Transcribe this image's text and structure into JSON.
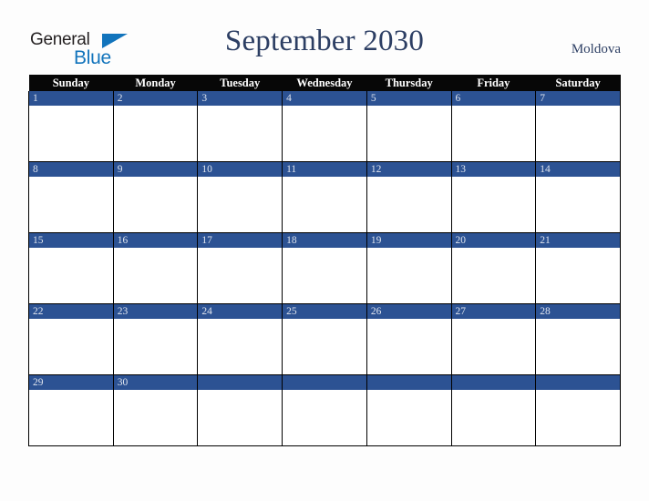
{
  "brand": {
    "name_top": "General",
    "name_bottom": "Blue",
    "triangle_color": "#1274bc",
    "top_color": "#231f20"
  },
  "header": {
    "title": "September 2030",
    "country": "Moldova",
    "title_color": "#2c3e63"
  },
  "colors": {
    "page_background": "#fdfdfd",
    "weekday_header_background": "#070707",
    "weekday_header_text": "#ffffff",
    "date_band_background": "#2c5293",
    "date_band_text": "#dfe4ee",
    "cell_background": "#ffffff",
    "grid_line": "#000000"
  },
  "calendar": {
    "month": "September",
    "year": "2030",
    "weekdays": [
      "Sunday",
      "Monday",
      "Tuesday",
      "Wednesday",
      "Thursday",
      "Friday",
      "Saturday"
    ],
    "weeks": [
      [
        "1",
        "2",
        "3",
        "4",
        "5",
        "6",
        "7"
      ],
      [
        "8",
        "9",
        "10",
        "11",
        "12",
        "13",
        "14"
      ],
      [
        "15",
        "16",
        "17",
        "18",
        "19",
        "20",
        "21"
      ],
      [
        "22",
        "23",
        "24",
        "25",
        "26",
        "27",
        "28"
      ],
      [
        "29",
        "30",
        "",
        "",
        "",
        "",
        ""
      ]
    ]
  }
}
